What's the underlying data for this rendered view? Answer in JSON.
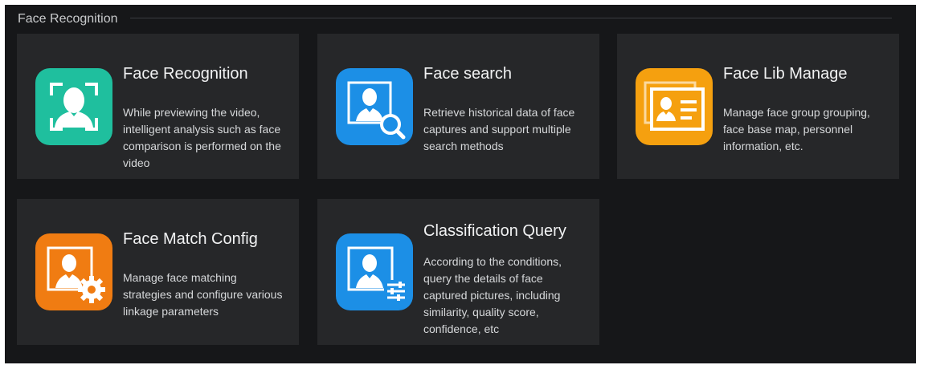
{
  "section": {
    "title": "Face Recognition"
  },
  "cards": [
    {
      "title": "Face Recognition",
      "description": "While previewing the video, intelligent analysis such as face comparison is performed on the video",
      "icon": "face-frame-icon",
      "icon_color": "#1fbf9e"
    },
    {
      "title": "Face search",
      "description": "Retrieve historical data of face captures and support multiple search methods",
      "icon": "face-search-icon",
      "icon_color": "#1c8fe6"
    },
    {
      "title": "Face Lib Manage",
      "description": "Manage face group grouping, face base map, personnel information, etc.",
      "icon": "id-card-icon",
      "icon_color": "#f5a00f"
    },
    {
      "title": "Face Match Config",
      "description": "Manage face matching strategies and configure various linkage parameters",
      "icon": "face-gear-icon",
      "icon_color": "#f07c12"
    },
    {
      "title": "Classification Query",
      "description": "According to the conditions, query the details of face captured pictures, including similarity, quality score, confidence, etc",
      "icon": "face-filter-icon",
      "icon_color": "#1c8fe6"
    }
  ]
}
